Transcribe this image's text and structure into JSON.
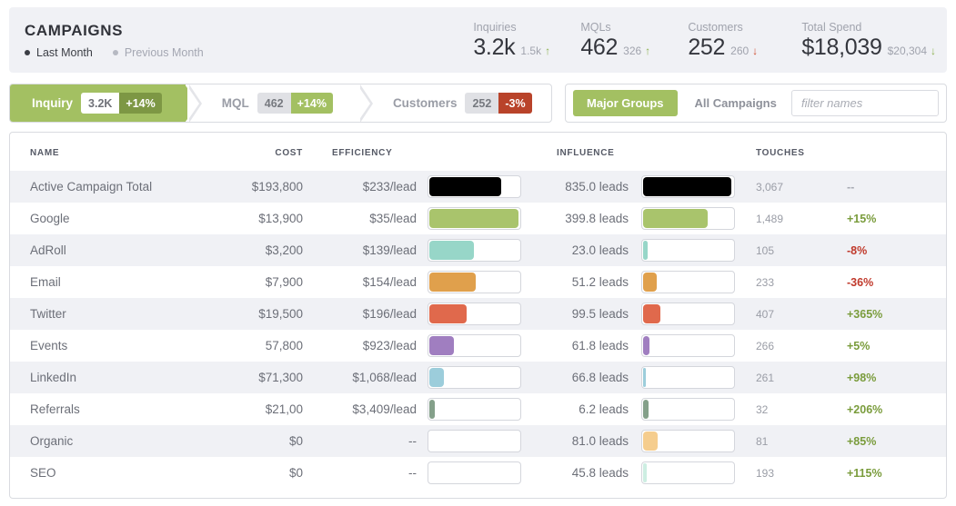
{
  "header": {
    "title": "CAMPAIGNS",
    "periods": [
      {
        "label": "Last Month",
        "active": true
      },
      {
        "label": "Previous Month",
        "active": false
      }
    ],
    "kpis": [
      {
        "label": "Inquiries",
        "value": "3.2k",
        "prev": "1.5k",
        "direction": "up",
        "arrow": "↑"
      },
      {
        "label": "MQLs",
        "value": "462",
        "prev": "326",
        "direction": "up",
        "arrow": "↑"
      },
      {
        "label": "Customers",
        "value": "252",
        "prev": "260",
        "direction": "down",
        "arrow": "↓"
      },
      {
        "label": "Total Spend",
        "value": "$18,039",
        "prev": "$20,304",
        "direction": "down-green",
        "arrow": "↓"
      }
    ]
  },
  "funnel": {
    "steps": [
      {
        "label": "Inquiry",
        "count": "3.2K",
        "change": "+14%",
        "active": true,
        "change_tone": "green"
      },
      {
        "label": "MQL",
        "count": "462",
        "change": "+14%",
        "active": false,
        "change_tone": "green"
      },
      {
        "label": "Customers",
        "count": "252",
        "change": "-3%",
        "active": false,
        "change_tone": "red"
      }
    ]
  },
  "segment": {
    "major_groups_label": "Major Groups",
    "all_campaigns_label": "All Campaigns",
    "filter_placeholder": "filter names",
    "filter_value": ""
  },
  "colors": {
    "accent_green": "#a3c062",
    "positive": "#7a9c3c",
    "negative": "#c0392b",
    "header_bg": "#f0f1f5"
  },
  "table": {
    "columns": [
      "NAME",
      "COST",
      "EFFICIENCY",
      "INFLUENCE",
      "TOUCHES"
    ],
    "rows": [
      {
        "name": "Active Campaign Total",
        "cost": "$193,800",
        "efficiency": "$233/lead",
        "eff_bar_pct": 78,
        "eff_color": "#000000",
        "influence": "835.0 leads",
        "infl_bar_pct": 96,
        "infl_color": "#000000",
        "touches": "3,067",
        "change": "--",
        "change_tone": "na"
      },
      {
        "name": "Google",
        "cost": "$13,900",
        "efficiency": "$35/lead",
        "eff_bar_pct": 97,
        "eff_color": "#a9c46c",
        "influence": "399.8 leads",
        "infl_bar_pct": 70,
        "infl_color": "#a9c46c",
        "touches": "1,489",
        "change": "+15%",
        "change_tone": "pos"
      },
      {
        "name": "AdRoll",
        "cost": "$3,200",
        "efficiency": "$139/lead",
        "eff_bar_pct": 49,
        "eff_color": "#97d6c8",
        "influence": "23.0 leads",
        "infl_bar_pct": 5,
        "infl_color": "#97d6c8",
        "touches": "105",
        "change": "-8%",
        "change_tone": "neg"
      },
      {
        "name": "Email",
        "cost": "$7,900",
        "efficiency": "$154/lead",
        "eff_bar_pct": 50,
        "eff_color": "#e0a04c",
        "influence": "51.2 leads",
        "infl_bar_pct": 15,
        "infl_color": "#e0a04c",
        "touches": "233",
        "change": "-36%",
        "change_tone": "neg"
      },
      {
        "name": "Twitter",
        "cost": "$19,500",
        "efficiency": "$196/lead",
        "eff_bar_pct": 41,
        "eff_color": "#e0694c",
        "influence": "99.5 leads",
        "infl_bar_pct": 19,
        "infl_color": "#e0694c",
        "touches": "407",
        "change": "+365%",
        "change_tone": "pos"
      },
      {
        "name": "Events",
        "cost": "57,800",
        "efficiency": "$923/lead",
        "eff_bar_pct": 27,
        "eff_color": "#a07ec0",
        "influence": "61.8 leads",
        "infl_bar_pct": 7,
        "infl_color": "#a07ec0",
        "touches": "266",
        "change": "+5%",
        "change_tone": "pos"
      },
      {
        "name": "LinkedIn",
        "cost": "$71,300",
        "efficiency": "$1,068/lead",
        "eff_bar_pct": 16,
        "eff_color": "#9ccddb",
        "influence": "66.8 leads",
        "infl_bar_pct": 3,
        "infl_color": "#9ccddb",
        "touches": "261",
        "change": "+98%",
        "change_tone": "pos"
      },
      {
        "name": "Referrals",
        "cost": "$21,00",
        "efficiency": "$3,409/lead",
        "eff_bar_pct": 6,
        "eff_color": "#84a08a",
        "influence": "6.2 leads",
        "infl_bar_pct": 6,
        "infl_color": "#84a08a",
        "touches": "32",
        "change": "+206%",
        "change_tone": "pos"
      },
      {
        "name": "Organic",
        "cost": "$0",
        "efficiency": "--",
        "eff_bar_pct": 0,
        "eff_color": "#f5cd8e",
        "influence": "81.0 leads",
        "infl_bar_pct": 16,
        "infl_color": "#f5cd8e",
        "touches": "81",
        "change": "+85%",
        "change_tone": "pos"
      },
      {
        "name": "SEO",
        "cost": "$0",
        "efficiency": "--",
        "eff_bar_pct": 0,
        "eff_color": "#cdeee2",
        "influence": "45.8 leads",
        "infl_bar_pct": 4,
        "infl_color": "#cdeee2",
        "touches": "193",
        "change": "+115%",
        "change_tone": "pos"
      }
    ]
  },
  "chart_data": {
    "type": "table",
    "title": "CAMPAIGNS",
    "categories": [
      "Active Campaign Total",
      "Google",
      "AdRoll",
      "Email",
      "Twitter",
      "Events",
      "LinkedIn",
      "Referrals",
      "Organic",
      "SEO"
    ],
    "series": [
      {
        "name": "Cost",
        "values": [
          193800,
          13900,
          3200,
          7900,
          19500,
          57800,
          71300,
          2100,
          0,
          0
        ]
      },
      {
        "name": "Efficiency ($/lead)",
        "values": [
          233,
          35,
          139,
          154,
          196,
          923,
          1068,
          3409,
          null,
          null
        ]
      },
      {
        "name": "Influence (leads)",
        "values": [
          835.0,
          399.8,
          23.0,
          51.2,
          99.5,
          61.8,
          66.8,
          6.2,
          81.0,
          45.8
        ]
      },
      {
        "name": "Touches",
        "values": [
          3067,
          1489,
          105,
          233,
          407,
          266,
          261,
          32,
          81,
          193
        ]
      },
      {
        "name": "Change (%)",
        "values": [
          null,
          15,
          -8,
          -36,
          365,
          5,
          98,
          206,
          85,
          115
        ]
      }
    ],
    "xlabel": "Campaign",
    "ylabel": ""
  }
}
